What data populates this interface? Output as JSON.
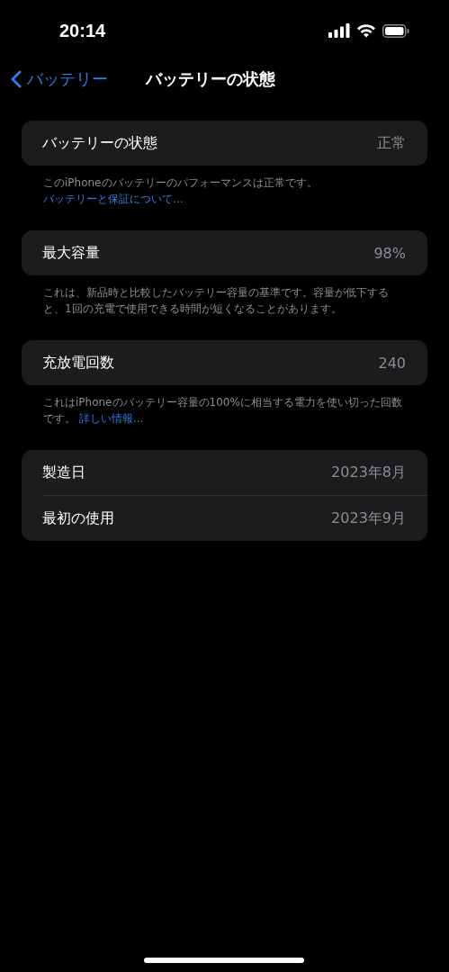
{
  "status_bar": {
    "time": "20:14"
  },
  "nav": {
    "back_label": "バッテリー",
    "title": "バッテリーの状態"
  },
  "sections": [
    {
      "rows": [
        {
          "label": "バッテリーの状態",
          "value": "正常"
        }
      ],
      "footer": {
        "text": "このiPhoneのバッテリーのパフォーマンスは正常です。",
        "link": "バッテリーと保証について..."
      }
    },
    {
      "rows": [
        {
          "label": "最大容量",
          "value": "98%"
        }
      ],
      "footer": {
        "text": "これは、新品時と比較したバッテリー容量の基準です。容量が低下すると、1回の充電で使用できる時間が短くなることがあります。"
      }
    },
    {
      "rows": [
        {
          "label": "充放電回数",
          "value": "240"
        }
      ],
      "footer": {
        "text": "これはiPhoneのバッテリー容量の100%に相当する電力を使い切った回数です。",
        "link": "詳しい情報..."
      }
    },
    {
      "rows": [
        {
          "label": "製造日",
          "value": "2023年8月"
        },
        {
          "label": "最初の使用",
          "value": "2023年9月"
        }
      ]
    }
  ]
}
